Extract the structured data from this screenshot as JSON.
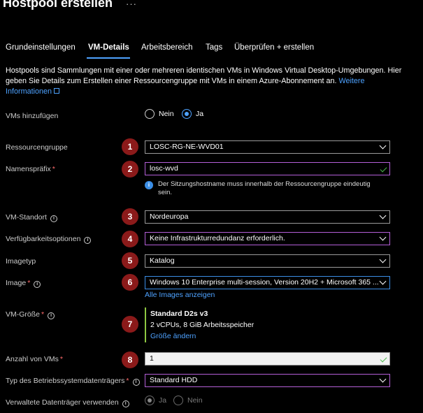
{
  "header": {
    "title": "Hostpool erstellen",
    "more": "···"
  },
  "tabs": [
    {
      "label": "Grundeinstellungen"
    },
    {
      "label": "VM-Details"
    },
    {
      "label": "Arbeitsbereich"
    },
    {
      "label": "Tags"
    },
    {
      "label": "Überprüfen + erstellen"
    }
  ],
  "description": {
    "text": "Hostpools sind Sammlungen mit einer oder mehreren identischen VMs in Windows Virtual Desktop-Umgebungen. Hier geben Sie Details zum Erstellen einer Ressourcengruppe mit VMs in einem Azure-Abonnement an.",
    "link": "Weitere Informationen"
  },
  "vms_hinzufuegen": {
    "label": "VMs hinzufügen",
    "options": [
      "Nein",
      "Ja"
    ],
    "selected": "Ja"
  },
  "ressourcengruppe": {
    "label": "Ressourcengruppe",
    "value": "LOSC-RG-NE-WVD01",
    "badge": "1"
  },
  "namenspraefix": {
    "label": "Namenspräfix",
    "required": "*",
    "value": "losc-wvd",
    "badge": "2",
    "hint": "Der Sitzungshostname muss innerhalb der Ressourcengruppe eindeutig sein."
  },
  "vm_standort": {
    "label": "VM-Standort",
    "value": "Nordeuropa",
    "badge": "3"
  },
  "verfuegbarkeit": {
    "label": "Verfügbarkeitsoptionen",
    "value": "Keine Infrastrukturredundanz erforderlich.",
    "badge": "4"
  },
  "imagetyp": {
    "label": "Imagetyp",
    "value": "Katalog",
    "badge": "5"
  },
  "image": {
    "label": "Image",
    "required": "*",
    "value": "Windows 10 Enterprise multi-session, Version 20H2 + Microsoft 365 ...",
    "link": "Alle Images anzeigen",
    "badge": "6"
  },
  "vm_groesse": {
    "label": "VM-Größe",
    "required": "*",
    "name": "Standard D2s v3",
    "spec": "2 vCPUs, 8 GiB Arbeitsspeicher",
    "link": "Größe ändern",
    "badge": "7"
  },
  "anzahl_vms": {
    "label": "Anzahl von VMs",
    "required": "*",
    "value": "1",
    "badge": "8"
  },
  "os_datentraeger": {
    "label": "Typ des Betriebssystemdatenträgers",
    "required": "*",
    "value": "Standard HDD"
  },
  "verwaltete_datentraeger": {
    "label": "Verwaltete Datenträger verwenden",
    "options": [
      "Ja",
      "Nein"
    ],
    "selected": "Ja"
  },
  "colors": {
    "accent": "#4ea2ff",
    "badge": "#8b1a1a",
    "focus": "#b45fd8",
    "success": "#8ec741"
  }
}
